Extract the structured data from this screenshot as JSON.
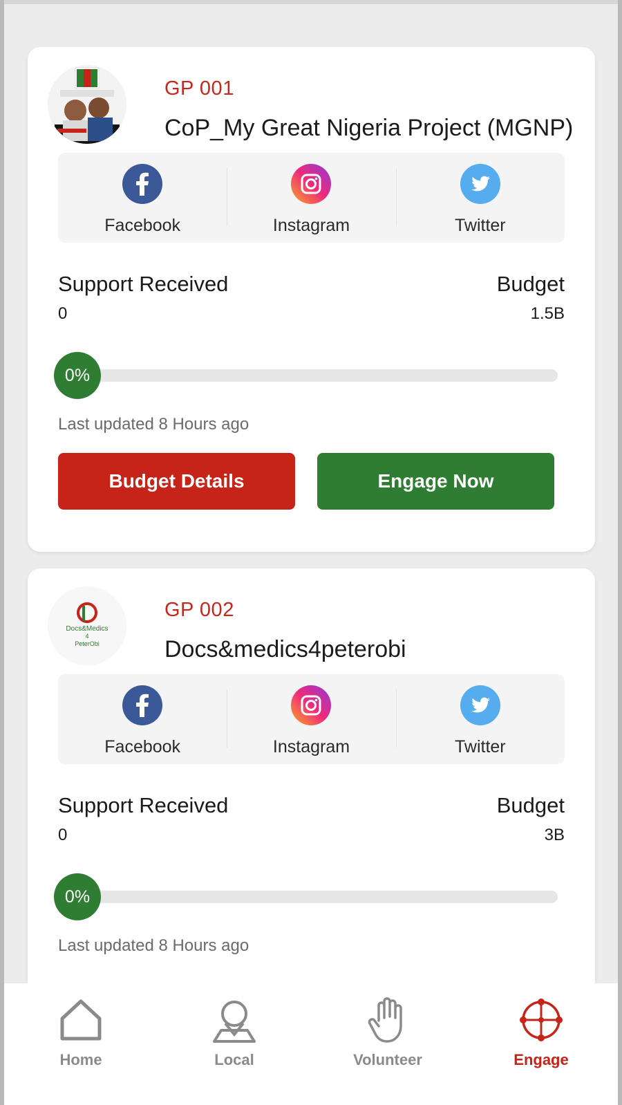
{
  "colors": {
    "accent_red": "#c62419",
    "accent_green": "#2e7d32",
    "progress_track": "#e6e6e6",
    "background": "#ececec"
  },
  "projects": [
    {
      "code": "GP 001",
      "name": "CoP_My Great Nigeria Project (MGNP)",
      "avatar_icon": "campaign-photo",
      "socials": [
        {
          "label": "Facebook",
          "icon": "facebook-icon"
        },
        {
          "label": "Instagram",
          "icon": "instagram-icon"
        },
        {
          "label": "Twitter",
          "icon": "twitter-icon"
        }
      ],
      "support_label": "Support Received",
      "support_value": "0",
      "budget_label": "Budget",
      "budget_value": "1.5B",
      "progress_text": "0%",
      "progress_fraction": 0,
      "updated": "Last updated 8 Hours ago",
      "budget_button": "Budget Details",
      "engage_button": "Engage Now"
    },
    {
      "code": "GP 002",
      "name": "Docs&medics4peterobi",
      "avatar_icon": "docs-medics-logo",
      "socials": [
        {
          "label": "Facebook",
          "icon": "facebook-icon"
        },
        {
          "label": "Instagram",
          "icon": "instagram-icon"
        },
        {
          "label": "Twitter",
          "icon": "twitter-icon"
        }
      ],
      "support_label": "Support Received",
      "support_value": "0",
      "budget_label": "Budget",
      "budget_value": "3B",
      "progress_text": "0%",
      "progress_fraction": 0,
      "updated": "Last updated 8 Hours ago"
    }
  ],
  "nav": [
    {
      "label": "Home",
      "icon": "home-icon",
      "active": false
    },
    {
      "label": "Local",
      "icon": "location-pin-icon",
      "active": false
    },
    {
      "label": "Volunteer",
      "icon": "raised-hand-icon",
      "active": false
    },
    {
      "label": "Engage",
      "icon": "crosshair-icon",
      "active": true
    }
  ]
}
